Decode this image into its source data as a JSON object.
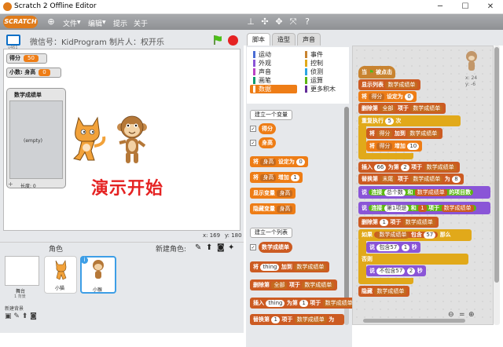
{
  "window": {
    "title": "Scratch 2 Offline Editor"
  },
  "menubar": {
    "logo": "SCRATCH",
    "file": "文件",
    "edit": "编辑",
    "tips": "提示",
    "about": "关于"
  },
  "stage": {
    "title": "微信号：KidProgram 制片人：权开乐",
    "version": "v461",
    "coords_x": "x: 169",
    "coords_y": "y: 180",
    "demo_text": "演示开始"
  },
  "monitors": {
    "score_label": "得分",
    "score_value": "50",
    "decimal_label": "小数: 身高",
    "decimal_value": "0",
    "list_title": "数学成绩单",
    "list_empty": "(empty)",
    "list_add": "+",
    "list_length": "长度: 0"
  },
  "sprites": {
    "label": "角色",
    "new_sprite": "新建角色:",
    "stage_label": "舞台",
    "stage_sub": "1 背景",
    "new_backdrop": "新建背景",
    "items": [
      {
        "name": "小猫"
      },
      {
        "name": "小猴"
      }
    ],
    "info": "i"
  },
  "tabs": {
    "scripts": "脚本",
    "costumes": "造型",
    "sounds": "声音"
  },
  "categories": {
    "left": [
      "运动",
      "外观",
      "声音",
      "画笔",
      "数据"
    ],
    "right": [
      "事件",
      "控制",
      "侦测",
      "运算",
      "更多积木"
    ]
  },
  "palette": {
    "make_var": "建立一个变量",
    "vars": [
      "得分",
      "身高"
    ],
    "set": "将",
    "set_var": "身高",
    "set_to": "设定为",
    "set_val": "0",
    "change": "将",
    "change_var": "身高",
    "change_by": "增加",
    "change_val": "1",
    "show": "显示变量",
    "show_var": "身高",
    "hide": "隐藏变量",
    "hide_var": "身高",
    "make_list": "建立一个列表",
    "list_name": "数学成绩单",
    "add_pre": "将",
    "add_item": "thing",
    "add_mid": "加到",
    "add_list": "数学成绩单",
    "del_pre": "删除第",
    "del_idx": "全部",
    "del_mid": "项于",
    "del_list": "数学成绩单",
    "ins_pre": "插入",
    "ins_item": "thing",
    "ins_mid": "为第",
    "ins_idx": "1",
    "ins_mid2": "项于",
    "ins_list": "数学成绩单",
    "rep_pre": "替换第",
    "rep_idx": "1",
    "rep_mid": "项于",
    "rep_list": "数学成绩单",
    "rep_post": "为"
  },
  "sprite_corner": {
    "x": "x: 24",
    "y": "y: -6"
  },
  "script": {
    "hat": "当",
    "hat_post": "被点击",
    "l1_pre": "显示列表",
    "l1_list": "数学成绩单",
    "l2_pre": "将",
    "l2_var": "得分",
    "l2_mid": "设定为",
    "l2_val": "0",
    "l3_pre": "删除第",
    "l3_idx": "全部",
    "l3_mid": "项于",
    "l3_list": "数学成绩单",
    "rep": "重复执行",
    "rep_n": "5",
    "rep_post": "次",
    "l4_pre": "将",
    "l4_var": "得分",
    "l4_mid": "加到",
    "l4_list": "数学成绩单",
    "l5_pre": "将",
    "l5_var": "得分",
    "l5_mid": "增加",
    "l5_val": "10",
    "l6_pre": "插入",
    "l6_val": "66",
    "l6_mid": "为第",
    "l6_idx": "2",
    "l6_mid2": "项于",
    "l6_list": "数学成绩单",
    "l7_pre": "替换第",
    "l7_idx": "末尾",
    "l7_mid": "项于",
    "l7_list": "数学成绩单",
    "l7_post": "为",
    "l7_val": "8",
    "l8_pre": "说",
    "l8_join": "连接",
    "l8_s1": "总个数",
    "l8_and": "和",
    "l8_list": "数学成绩单",
    "l8_post": "的项目数",
    "l9_pre": "说",
    "l9_join": "连接",
    "l9_s1": "第1项是",
    "l9_and": "和",
    "l9_idx": "1",
    "l9_mid": "项于",
    "l9_list": "数学成绩单",
    "l10_pre": "删除第",
    "l10_idx": "1",
    "l10_mid": "项于",
    "l10_list": "数学成绩单",
    "if": "如果",
    "if_list": "数学成绩单",
    "if_cont": "包含",
    "if_val": "57",
    "if_post": "那么",
    "say1_pre": "说",
    "say1_txt": "包含57",
    "say1_n": "1",
    "say1_post": "秒",
    "else": "否则",
    "say2_pre": "说",
    "say2_txt": "不包含57",
    "say2_n": "2",
    "say2_post": "秒",
    "hide_pre": "隐藏",
    "hide_list": "数学成绩单"
  },
  "colors": {
    "data": "#ee7d16",
    "list": "#cc5b22",
    "control": "#e1a91a",
    "looks": "#8a55d7",
    "operators": "#5cb712",
    "events": "#c88330"
  }
}
